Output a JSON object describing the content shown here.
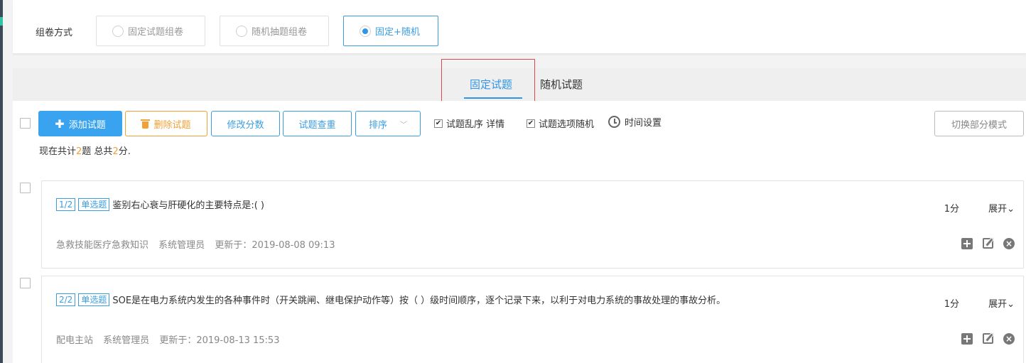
{
  "mode": {
    "label": "组卷方式",
    "options": [
      {
        "label": "固定试题组卷",
        "selected": false
      },
      {
        "label": "随机抽题组卷",
        "selected": false
      },
      {
        "label": "固定+随机",
        "selected": true
      }
    ]
  },
  "tabs": [
    {
      "label": "固定试题",
      "active": true
    },
    {
      "label": "随机试题",
      "active": false
    }
  ],
  "toolbar": {
    "add_label": "添加试题",
    "delete_label": "删除试题",
    "score_label": "修改分数",
    "duplicate_label": "试题查重",
    "sort_label": "排序",
    "shuffle_label": "试题乱序 详情",
    "shuffle_checked": true,
    "option_random_label": "试题选项随机",
    "option_random_checked": true,
    "time_label": "时间设置",
    "switch_label": "切换部分模式"
  },
  "summary": {
    "prefix": "现在共计",
    "count": "2",
    "mid": "题 总共",
    "total": "2",
    "suffix": "分."
  },
  "questions": [
    {
      "index": "1/2",
      "type": "单选题",
      "text": "鉴别右心衰与肝硬化的主要特点是:( )",
      "score": "1分",
      "expand": "展开",
      "category": "急救技能医疗急救知识",
      "author": "系统管理员",
      "updated": "更新于：2019-08-08 09:13"
    },
    {
      "index": "2/2",
      "type": "单选题",
      "text": "SOE是在电力系统内发生的各种事件时（开关跳闸、继电保护动作等）按（ ）级时间顺序，逐个记录下来，以利于对电力系统的事故处理的事故分析。",
      "score": "1分",
      "expand": "展开",
      "category": "配电主站",
      "author": "系统管理员",
      "updated": "更新于：2019-08-13 15:53"
    }
  ]
}
